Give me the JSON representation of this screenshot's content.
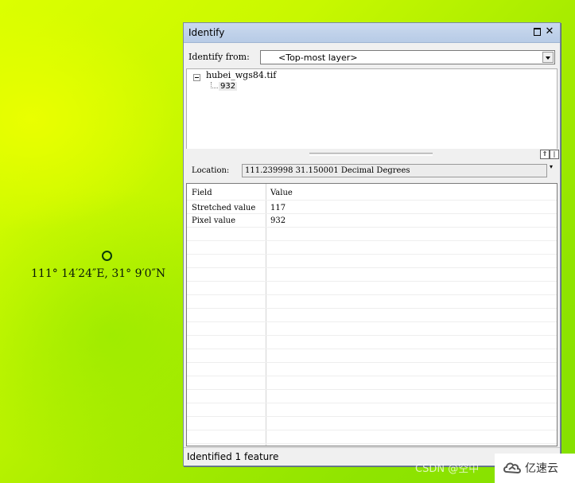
{
  "map": {
    "coordinate_label": "111° 14′24″E, 31° 9′0″N"
  },
  "identify_window": {
    "title": "Identify",
    "identify_from_label": "Identify from:",
    "identify_from_value": "<Top-most layer>",
    "tree": {
      "layer": "hubei_wgs84.tif",
      "value": "932"
    },
    "location_label": "Location:",
    "location_value": "111.239998  31.150001 Decimal Degrees",
    "table": {
      "headers": [
        "Field",
        "Value"
      ],
      "rows": [
        {
          "field": "Stretched value",
          "value": "117"
        },
        {
          "field": "Pixel value",
          "value": "932"
        }
      ]
    },
    "status": "Identified 1 feature"
  },
  "watermarks": {
    "csdn": "CSDN @空中",
    "logo_text": "亿速云"
  }
}
